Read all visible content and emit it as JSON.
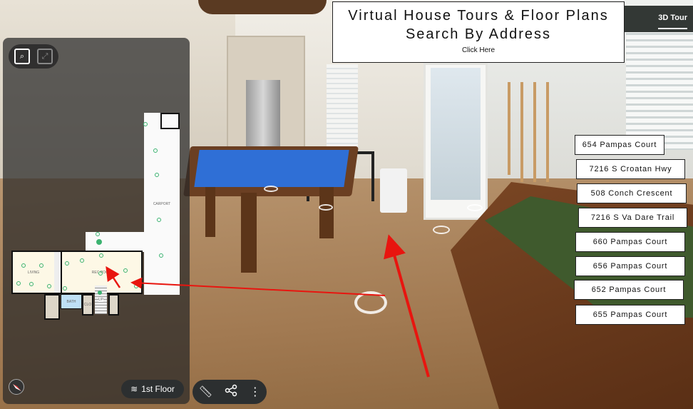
{
  "banner": {
    "line1": "Virtual House Tours & Floor Plans",
    "line2": "Search By Address",
    "link": "Click Here"
  },
  "view_tabs": {
    "active": "3D Tour"
  },
  "addresses": [
    "654 Pampas Court",
    "7216 S Croatan Hwy",
    "508 Conch Crescent",
    "7216 S Va Dare Trail",
    "660 Pampas Court",
    "656 Pampas Court",
    "652 Pampas Court",
    "655 Pampas Court"
  ],
  "minimap": {
    "rooms": {
      "living": "LIVING",
      "rec_room": "REC ROOM",
      "carport": "CARPORT",
      "bath": "BATH",
      "closet": "CLO",
      "stairs": "UP"
    },
    "floor_selector": "1st Floor",
    "icons": [
      "zoom-map-icon",
      "fullscreen-icon",
      "compass-icon",
      "layers-icon"
    ]
  },
  "toolbar": {
    "icons": [
      "measure-ruler-icon",
      "share-icon",
      "more-options-icon"
    ]
  },
  "colors": {
    "annotation_arrow": "#e8150f",
    "pool_felt": "#2f6fd6",
    "scan_point": "#3cb371"
  }
}
